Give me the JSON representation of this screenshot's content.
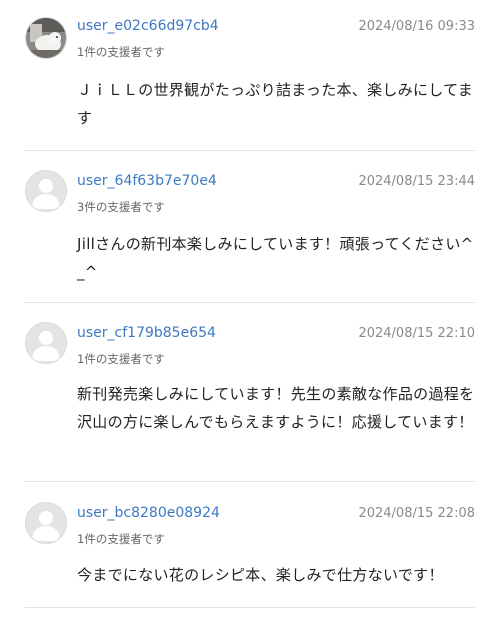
{
  "comments": [
    {
      "username": "user_e02c66d97cb4",
      "supporter_count": "1件の支援者です",
      "timestamp": "2024/08/16 09:33",
      "text": "ＪｉＬＬの世界観がたっぷり詰まった本、楽しみにしてます",
      "avatar": "user-photo-avatar"
    },
    {
      "username": "user_64f63b7e70e4",
      "supporter_count": "3件の支援者です",
      "timestamp": "2024/08/15 23:44",
      "text": "Jillさんの新刊本楽しみにしています！頑張ってください^_^",
      "avatar": "default-user-icon"
    },
    {
      "username": "user_cf179b85e654",
      "supporter_count": "1件の支援者です",
      "timestamp": "2024/08/15 22:10",
      "text": "新刊発売楽しみにしています！先生の素敵な作品の過程を沢山の方に楽しんでもらえますように！応援しています！",
      "avatar": "default-user-icon"
    },
    {
      "username": "user_bc8280e08924",
      "supporter_count": "1件の支援者です",
      "timestamp": "2024/08/15 22:08",
      "text": "今までにない花のレシピ本、楽しみで仕方ないです！",
      "avatar": "default-user-icon"
    }
  ]
}
